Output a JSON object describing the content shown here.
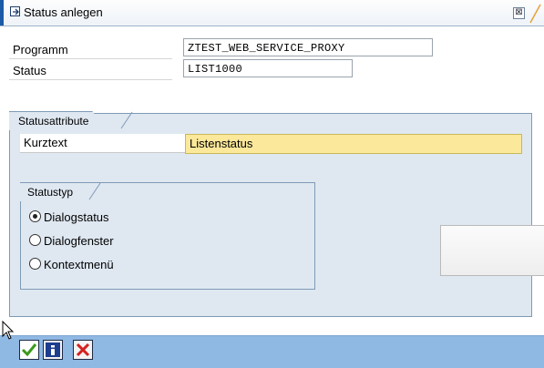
{
  "window": {
    "title": "Status anlegen",
    "close_glyph": "⊠"
  },
  "fields": {
    "programm_label": "Programm",
    "programm_value": "ZTEST_WEB_SERVICE_PROXY",
    "status_label": "Status",
    "status_value": "LIST1000"
  },
  "statusattribute": {
    "group_title": "Statusattribute",
    "kurztext_label": "Kurztext",
    "kurztext_value": "Listenstatus"
  },
  "statustyp": {
    "group_title": "Statustyp",
    "options": [
      {
        "label": "Dialogstatus",
        "selected": true
      },
      {
        "label": "Dialogfenster",
        "selected": false
      },
      {
        "label": "Kontextmenü",
        "selected": false
      }
    ]
  },
  "footer": {
    "icons": [
      "check-icon",
      "info-icon",
      "cancel-icon"
    ]
  },
  "colors": {
    "accent_blue": "#1a5aa6",
    "footer_bg": "#8fb8e3",
    "required_field": "#fbe89a",
    "group_bg": "#dfe8f1"
  }
}
